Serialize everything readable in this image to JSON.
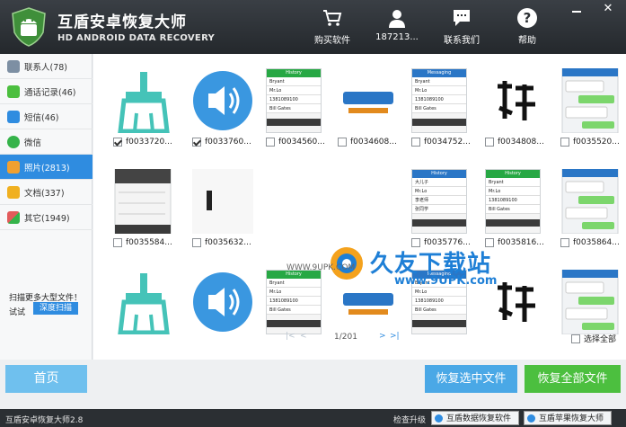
{
  "header": {
    "title": "互盾安卓恢复大师",
    "subtitle": "HD ANDROID DATA RECOVERY",
    "buy_label": "购买软件",
    "account_label": "187213...",
    "contact_label": "联系我们",
    "help_label": "帮助"
  },
  "sidebar": {
    "items": [
      {
        "label": "联系人(78)",
        "icon": "contacts-icon",
        "color": "#7d8fa3"
      },
      {
        "label": "通话记录(46)",
        "icon": "phone-icon",
        "color": "#4cbf3f"
      },
      {
        "label": "短信(46)",
        "icon": "sms-icon",
        "color": "#2f8ce0"
      },
      {
        "label": "微信",
        "icon": "wechat-icon",
        "color": "#35b34a"
      },
      {
        "label": "照片(2813)",
        "icon": "photo-icon",
        "color": "#f0a030"
      },
      {
        "label": "文档(337)",
        "icon": "document-icon",
        "color": "#f0b020"
      },
      {
        "label": "其它(1949)",
        "icon": "other-icon",
        "color": "#e25b5b"
      }
    ],
    "scan_text": "扫描更多大型文件！",
    "scan_try": "试试",
    "scan_button": "深度扫描"
  },
  "thumbnails": [
    {
      "name": "f0033720...",
      "checked": true,
      "kind": "broom"
    },
    {
      "name": "f0033760...",
      "checked": true,
      "kind": "speaker"
    },
    {
      "name": "f0034560...",
      "checked": false,
      "kind": "history"
    },
    {
      "name": "f0034608...",
      "checked": false,
      "kind": "logo"
    },
    {
      "name": "f0034752...",
      "checked": false,
      "kind": "messaging"
    },
    {
      "name": "f0034808...",
      "checked": false,
      "kind": "calligraphy"
    },
    {
      "name": "f0035520...",
      "checked": false,
      "kind": "chat"
    },
    {
      "name": "f0035584...",
      "checked": false,
      "kind": "addcontact"
    },
    {
      "name": "f0035632...",
      "checked": false,
      "kind": "blank"
    },
    {
      "name": "",
      "checked": false,
      "kind": "none"
    },
    {
      "name": "",
      "checked": false,
      "kind": "none"
    },
    {
      "name": "f0035776...",
      "checked": false,
      "kind": "contacts2"
    },
    {
      "name": "f0035816...",
      "checked": false,
      "kind": "history"
    },
    {
      "name": "f0035864...",
      "checked": false,
      "kind": "chat"
    },
    {
      "name": "",
      "checked": false,
      "kind": "broom"
    },
    {
      "name": "",
      "checked": false,
      "kind": "speaker"
    },
    {
      "name": "",
      "checked": false,
      "kind": "history"
    },
    {
      "name": "",
      "checked": false,
      "kind": "logo"
    },
    {
      "name": "",
      "checked": false,
      "kind": "messaging"
    },
    {
      "name": "",
      "checked": false,
      "kind": "calligraphy"
    },
    {
      "name": "",
      "checked": false,
      "kind": "chat"
    }
  ],
  "phone_text": {
    "history": "History",
    "messaging": "Messaging",
    "contacts": [
      "Bryant",
      "Mr.Lo",
      "1381089100",
      "Bill Gates"
    ],
    "deleted": "Deleted",
    "compose": "Compose",
    "add_contact": "Add contact",
    "contacts_cn": [
      "大儿子",
      "Mr.Lo",
      "李老师",
      "张同学"
    ]
  },
  "pager": {
    "first": "|<",
    "prev": "<",
    "page": "1/201",
    "next": ">",
    "last": ">|",
    "select_all": "选择全部"
  },
  "watermark": {
    "text": "久友下载站",
    "url": "www.9UPK.com",
    "small": "WWW.9UPK.COM"
  },
  "bottom": {
    "home": "首页",
    "recover_selected": "恢复选中文件",
    "recover_all": "恢复全部文件"
  },
  "status": {
    "version": "互盾安卓恢复大师2.8",
    "check": "检查升级",
    "link1": "互盾数据恢复软件",
    "link2": "互盾苹果恢复大师"
  },
  "colors": {
    "accent": "#2f8ce0",
    "green": "#4cbf3f",
    "header": "#2b2f33"
  }
}
